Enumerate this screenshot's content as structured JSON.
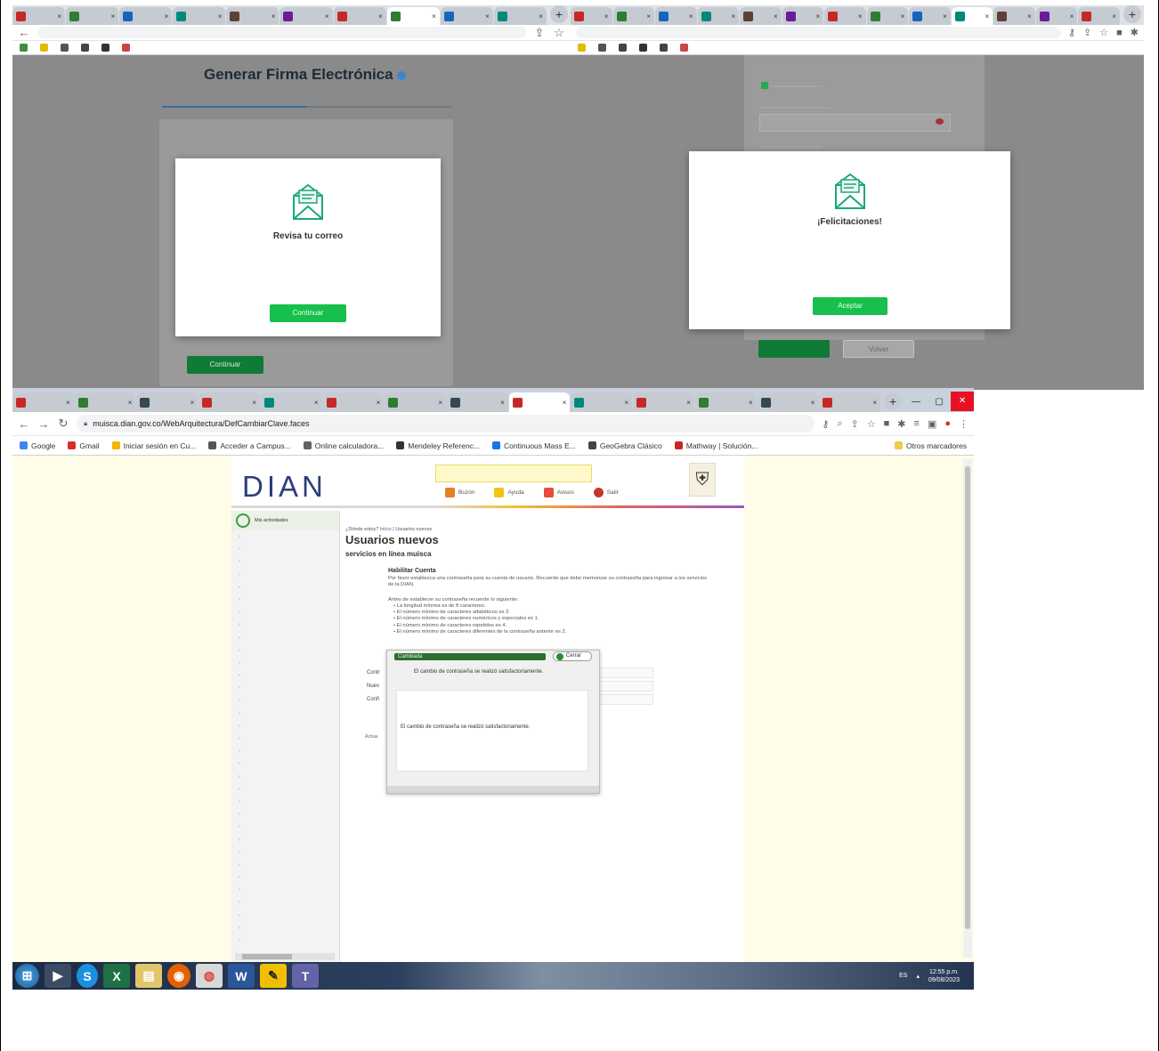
{
  "top_left": {
    "tabs": [
      "",
      "",
      "",
      "",
      "",
      "",
      "",
      "",
      "",
      ""
    ],
    "url": "",
    "page_title": "Generar Firma Electrónica",
    "progress_fraction": 0.5,
    "modal": {
      "title": "Revisa tu correo",
      "text": "",
      "email": "",
      "button": "Continuar"
    },
    "under_button": "Continuar"
  },
  "top_right": {
    "tabs": [
      "",
      "",
      "",
      "",
      "",
      "",
      "",
      "",
      "",
      "",
      "",
      "",
      ""
    ],
    "url": "",
    "input_value": "",
    "modal": {
      "title": "¡Felicitaciones!",
      "text": "",
      "email": "",
      "button": "Aceptar"
    },
    "under_buttons": [
      "",
      "Volver"
    ]
  },
  "bottom": {
    "tabs": [
      "",
      "",
      "",
      "",
      "",
      "",
      "",
      "",
      "",
      "",
      "",
      "",
      "",
      ""
    ],
    "url": "muisca.dian.gov.co/WebArquitectura/DefCambiarClave.faces",
    "bookmarks": [
      "Google",
      "Gmail",
      "Iniciar sesión en Cu...",
      "Acceder a Campus...",
      "Online calculadora...",
      "Mendeley Referenc...",
      "Continuous Mass E...",
      "GeoGebra Clásico",
      "Mathway | Solución..."
    ],
    "bookmarks_other": "Otros marcadores",
    "dian": {
      "logo": "DIAN",
      "nav": [
        "Buzón",
        "Ayuda",
        "Avisos",
        "Salir"
      ],
      "sidebar_header": "Mis actividades",
      "sidebar_items": [
        "",
        "",
        "",
        "",
        "",
        "",
        "",
        "",
        "",
        "",
        "",
        "",
        "",
        "",
        "",
        "",
        "",
        "",
        "",
        "",
        "",
        "",
        "",
        "",
        "",
        "",
        "",
        "",
        "",
        "",
        "",
        "",
        ""
      ],
      "breadcrumb_q": "¿Dónde estoy?",
      "breadcrumb_home": "Inicio",
      "breadcrumb_current": "Usuarios nuevos",
      "title": "Usuarios nuevos",
      "subtitle": "servicios en línea muisca",
      "section_title": "Habilitar Cuenta",
      "intro": "Por favor establezca una contraseña para su cuenta de usuario. Recuerde que debe memorizar su contraseña para ingresar a los servicios de la DIAN.",
      "rules_intro": "Antes de establecer su contraseña recuerde lo siguiente:",
      "rules": [
        "La longitud mínima es de 8 caracteres.",
        "El número mínimo de caracteres alfabéticos es 2.",
        "El número mínimo de caracteres numéricos y especiales es 1.",
        "El número mínimo de caracteres repetidos es 4.",
        "El número mínimo de caracteres diferentes de la contraseña anterior es 2."
      ],
      "field_labels": [
        "Contr",
        "Nuev",
        "Confi"
      ],
      "update_label": "Actua"
    },
    "dialog": {
      "title": "Cambiada",
      "close": "Cerrar",
      "message_top": "El cambio de contraseña se realizó satisfactoriamente.",
      "message_inner": "El cambio de contraseña se realizó satisfactoriamente."
    },
    "taskbar": {
      "lang": "ES",
      "time": "12:55 p.m.",
      "date": "09/08/2023"
    }
  },
  "colors": {
    "dian_blue": "#2c3e7b",
    "green_button": "#17c04c",
    "dialog_green": "#2c6e2f"
  }
}
